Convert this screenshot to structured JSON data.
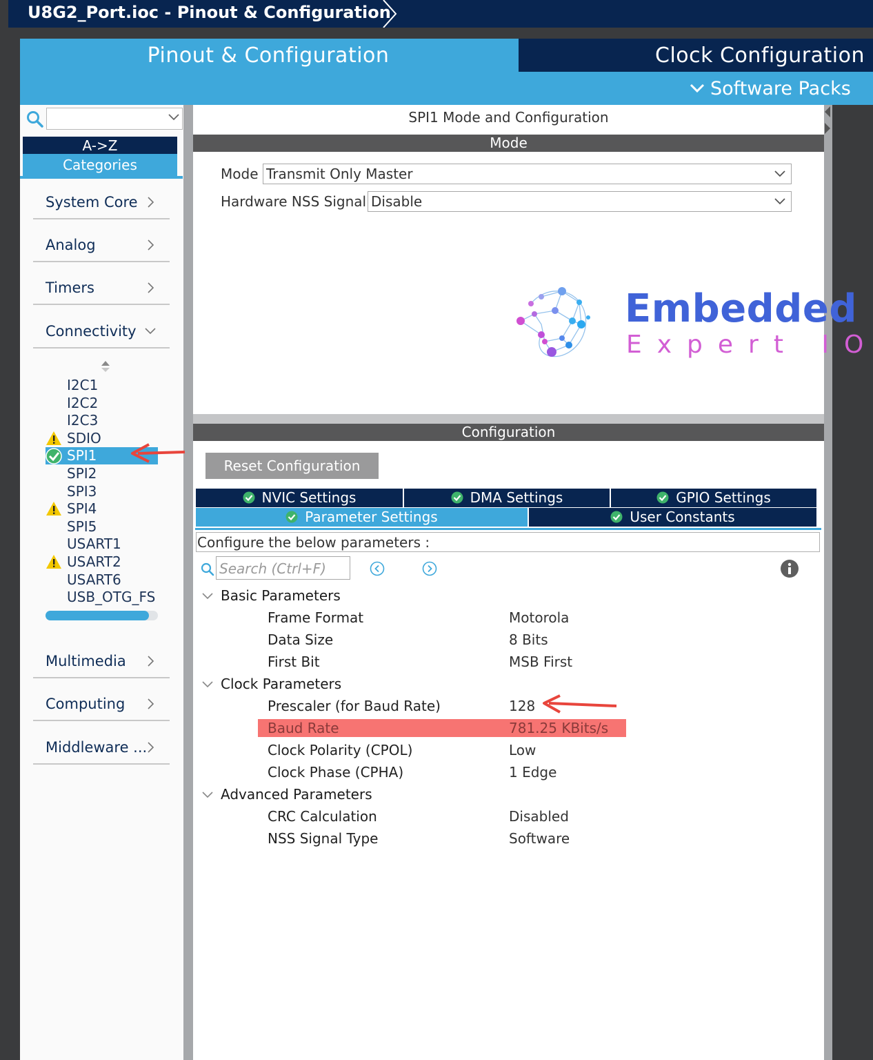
{
  "window": {
    "title": "U8G2_Port.ioc - Pinout & Configuration"
  },
  "top_tabs": {
    "pinout": "Pinout & Configuration",
    "clock": "Clock Configuration",
    "packs": "Software Packs"
  },
  "sidebar": {
    "search_value": "",
    "sort_az": "A->Z",
    "categories_btn": "Categories",
    "categories": [
      {
        "label": "System Core"
      },
      {
        "label": "Analog"
      },
      {
        "label": "Timers"
      },
      {
        "label": "Connectivity"
      },
      {
        "label": "Multimedia"
      },
      {
        "label": "Computing"
      },
      {
        "label": "Middleware ..."
      }
    ],
    "peripherals": [
      {
        "label": "I2C1",
        "status": "none"
      },
      {
        "label": "I2C2",
        "status": "none"
      },
      {
        "label": "I2C3",
        "status": "none"
      },
      {
        "label": "SDIO",
        "status": "warning"
      },
      {
        "label": "SPI1",
        "status": "ok"
      },
      {
        "label": "SPI2",
        "status": "none"
      },
      {
        "label": "SPI3",
        "status": "none"
      },
      {
        "label": "SPI4",
        "status": "warning"
      },
      {
        "label": "SPI5",
        "status": "none"
      },
      {
        "label": "USART1",
        "status": "none"
      },
      {
        "label": "USART2",
        "status": "warning"
      },
      {
        "label": "USART6",
        "status": "none"
      },
      {
        "label": "USB_OTG_FS",
        "status": "none"
      }
    ],
    "selected": "SPI1"
  },
  "mode_panel": {
    "title": "SPI1 Mode and Configuration",
    "section": "Mode",
    "mode_label": "Mode",
    "mode_value": "Transmit Only Master",
    "nss_label": "Hardware NSS Signal",
    "nss_value": "Disable"
  },
  "logo": {
    "line1": "Embedded",
    "line2": "Expert IO"
  },
  "config_panel": {
    "section": "Configuration",
    "reset_button": "Reset Configuration",
    "tabs": {
      "nvic": "NVIC Settings",
      "dma": "DMA Settings",
      "gpio": "GPIO Settings",
      "params": "Parameter Settings",
      "user": "User Constants"
    },
    "description": "Configure the below parameters :",
    "search_placeholder": "Search (Ctrl+F)",
    "groups": {
      "basic": "Basic Parameters",
      "clock": "Clock Parameters",
      "advanced": "Advanced Parameters"
    },
    "params": {
      "frame_format": {
        "name": "Frame Format",
        "value": "Motorola"
      },
      "data_size": {
        "name": "Data Size",
        "value": "8 Bits"
      },
      "first_bit": {
        "name": "First Bit",
        "value": "MSB First"
      },
      "prescaler": {
        "name": "Prescaler (for Baud Rate)",
        "value": "128"
      },
      "baud_rate": {
        "name": "Baud Rate",
        "value": "781.25 KBits/s"
      },
      "cpol": {
        "name": "Clock Polarity (CPOL)",
        "value": "Low"
      },
      "cpha": {
        "name": "Clock Phase (CPHA)",
        "value": "1 Edge"
      },
      "crc": {
        "name": "CRC Calculation",
        "value": "Disabled"
      },
      "nss_type": {
        "name": "NSS Signal Type",
        "value": "Software"
      }
    }
  },
  "colors": {
    "navy": "#082550",
    "accent": "#3ea8db",
    "highlight": "#f77472",
    "annotation_arrow": "#e8453c",
    "ok": "#3fb36b",
    "warning": "#f3c800"
  }
}
